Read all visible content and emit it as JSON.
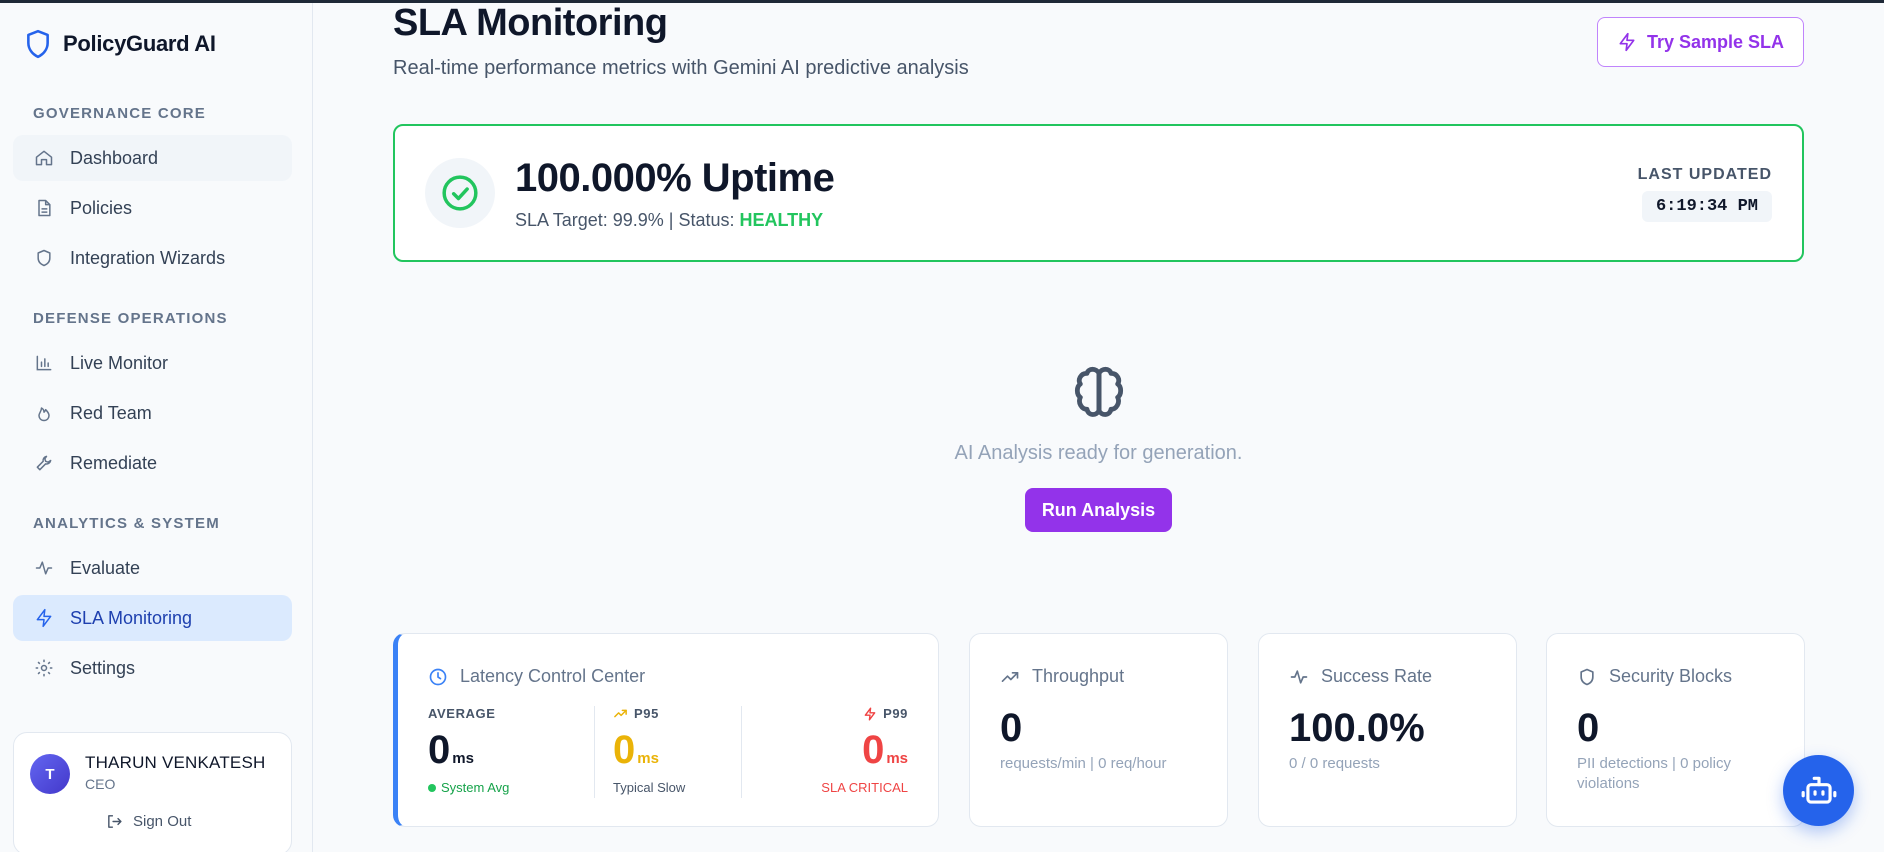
{
  "app": {
    "name": "PolicyGuard AI"
  },
  "sidebar": {
    "sections": [
      {
        "title": "GOVERNANCE CORE"
      },
      {
        "title": "DEFENSE OPERATIONS"
      },
      {
        "title": "ANALYTICS & SYSTEM"
      }
    ],
    "items": [
      {
        "label": "Dashboard",
        "icon": "home-icon"
      },
      {
        "label": "Policies",
        "icon": "file-icon"
      },
      {
        "label": "Integration Wizards",
        "icon": "shield-icon"
      },
      {
        "label": "Live Monitor",
        "icon": "bar-chart-icon"
      },
      {
        "label": "Red Team",
        "icon": "flame-icon"
      },
      {
        "label": "Remediate",
        "icon": "wrench-icon"
      },
      {
        "label": "Evaluate",
        "icon": "activity-icon"
      },
      {
        "label": "SLA Monitoring",
        "icon": "zap-icon",
        "active": true
      },
      {
        "label": "Settings",
        "icon": "gear-icon"
      }
    ]
  },
  "user": {
    "initial": "T",
    "name": "THARUN VENKATESH",
    "role": "CEO",
    "signout_label": "Sign Out"
  },
  "header": {
    "title": "SLA Monitoring",
    "subtitle": "Real-time performance metrics with Gemini AI predictive analysis",
    "sample_button": "Try Sample SLA"
  },
  "uptime": {
    "value": "100.000% Uptime",
    "target_text": "SLA Target: 99.9% | Status:",
    "status": "HEALTHY",
    "last_updated_label": "LAST UPDATED",
    "last_updated_time": "6:19:34 PM"
  },
  "ai": {
    "message": "AI Analysis ready for generation.",
    "run_button": "Run Analysis"
  },
  "latency": {
    "title": "Latency Control Center",
    "average": {
      "label": "AVERAGE",
      "value": "0",
      "unit": "ms",
      "foot": "System Avg"
    },
    "p95": {
      "label": "P95",
      "value": "0",
      "unit": "ms",
      "foot": "Typical Slow"
    },
    "p99": {
      "label": "P99",
      "value": "0",
      "unit": "ms",
      "foot": "SLA CRITICAL"
    }
  },
  "stats": {
    "throughput": {
      "title": "Throughput",
      "value": "0",
      "sub": "requests/min | 0 req/hour"
    },
    "success": {
      "title": "Success Rate",
      "value": "100.0%",
      "sub": "0 / 0 requests"
    },
    "security": {
      "title": "Security Blocks",
      "value": "0",
      "sub": "PII detections | 0 policy violations"
    }
  },
  "colors": {
    "accent": "#9333ea",
    "active_nav": "#dbeafe",
    "healthy": "#22c55e",
    "p95": "#eab308",
    "p99": "#ef4444",
    "latency_bar": "#3b82f6"
  }
}
